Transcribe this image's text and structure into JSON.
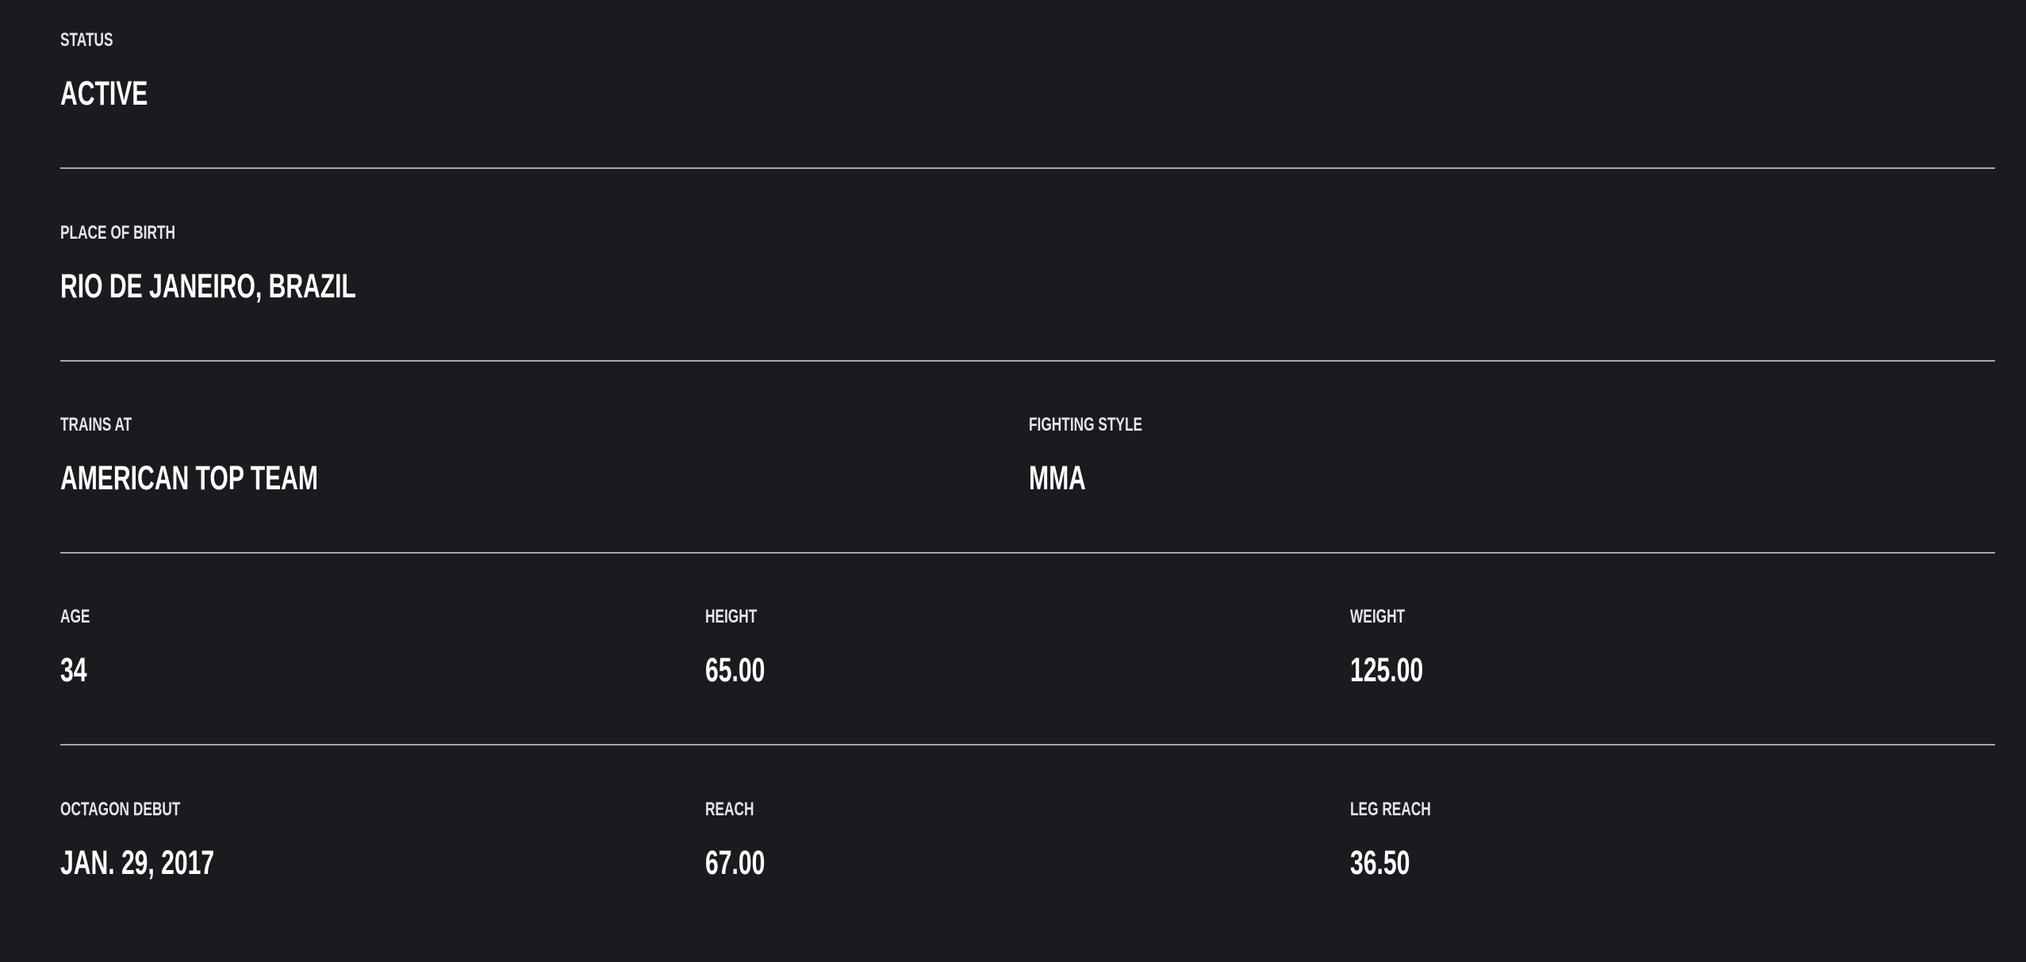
{
  "rows": [
    [
      {
        "label": "STATUS",
        "value": "ACTIVE"
      }
    ],
    [
      {
        "label": "PLACE OF BIRTH",
        "value": "RIO DE JANEIRO, BRAZIL"
      }
    ],
    [
      {
        "label": "TRAINS AT",
        "value": "AMERICAN TOP TEAM"
      },
      {
        "label": "FIGHTING STYLE",
        "value": "MMA"
      }
    ],
    [
      {
        "label": "AGE",
        "value": "34"
      },
      {
        "label": "HEIGHT",
        "value": "65.00"
      },
      {
        "label": "WEIGHT",
        "value": "125.00"
      }
    ],
    [
      {
        "label": "OCTAGON DEBUT",
        "value": "JAN. 29, 2017"
      },
      {
        "label": "REACH",
        "value": "67.00"
      },
      {
        "label": "LEG REACH",
        "value": "36.50"
      }
    ]
  ]
}
